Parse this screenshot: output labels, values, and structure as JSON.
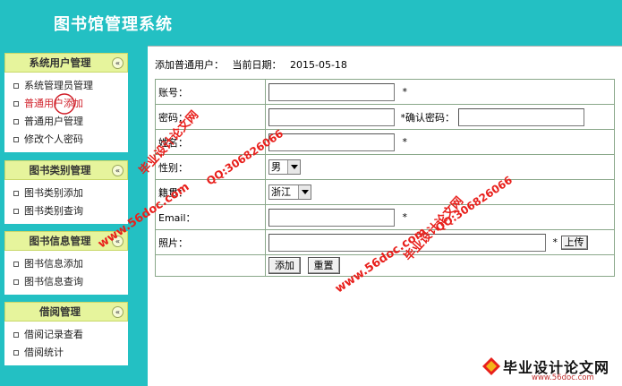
{
  "header": {
    "title": "图书馆管理系统"
  },
  "sidebar": {
    "panels": [
      {
        "title": "系统用户管理",
        "items": [
          {
            "label": "系统管理员管理"
          },
          {
            "label": "普通用户添加"
          },
          {
            "label": "普通用户管理"
          },
          {
            "label": "修改个人密码"
          }
        ]
      },
      {
        "title": "图书类别管理",
        "items": [
          {
            "label": "图书类别添加"
          },
          {
            "label": "图书类别查询"
          }
        ]
      },
      {
        "title": "图书信息管理",
        "items": [
          {
            "label": "图书信息添加"
          },
          {
            "label": "图书信息查询"
          }
        ]
      },
      {
        "title": "借阅管理",
        "items": [
          {
            "label": "借阅记录查看"
          },
          {
            "label": "借阅统计"
          }
        ]
      }
    ],
    "collapse_glyph": "«",
    "active_item": "普通用户添加"
  },
  "main": {
    "crumb": {
      "title": "添加普通用户：",
      "date_label": "当前日期：",
      "date": "2015-05-18"
    },
    "form": {
      "account_label": "账号：",
      "password_label": "密码：",
      "confirm_label": "*确认密码：",
      "name_label": "姓名：",
      "gender_label": "性别：",
      "gender_value": "男",
      "origin_label": "籍贯：",
      "origin_value": "浙江",
      "email_label": "Email：",
      "photo_label": "照片：",
      "required_mark": "*",
      "upload_label": "上传",
      "add_label": "添加",
      "reset_label": "重置"
    }
  },
  "watermarks": {
    "site": "www.56doc.com",
    "qq": "QQ:306826066",
    "brand": "毕业设计论文网"
  },
  "footer": {
    "brand": "毕业设计论文网",
    "url": "www.56doc.com"
  },
  "colors": {
    "teal": "#23c0c3",
    "panel_head": "#e6f49c",
    "active_red": "#d0202a"
  }
}
